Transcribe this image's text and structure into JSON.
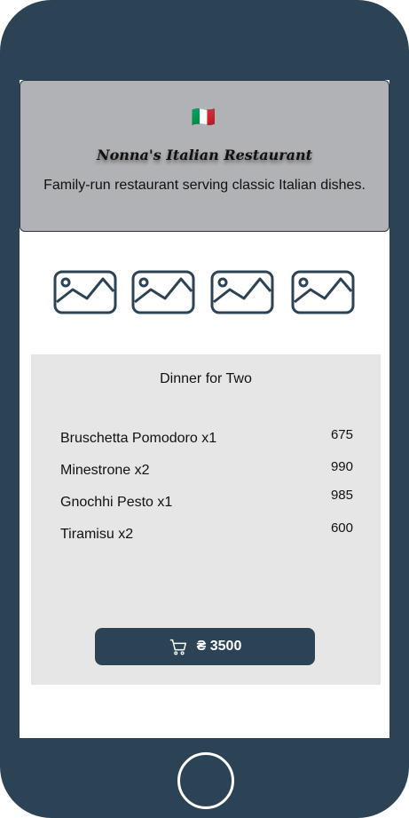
{
  "restaurant": {
    "logo": "🇮🇹",
    "name": "Nonna's Italian Restaurant",
    "description": "Family-run restaurant serving classic Italian dishes."
  },
  "gallery": {
    "icons": [
      "image-icon",
      "image-icon",
      "image-icon",
      "image-icon"
    ]
  },
  "menu": {
    "title": "Dinner for Two",
    "items": [
      {
        "name": "Bruschetta Pomodoro x1",
        "price": "675"
      },
      {
        "name": "Minestrone x2",
        "price": "990"
      },
      {
        "name": "Gnochhi Pesto x1",
        "price": "985"
      },
      {
        "name": "Tiramisu x2",
        "price": "600"
      }
    ],
    "cart_button": {
      "icon": "cart-icon",
      "label": "₴ 3500"
    }
  },
  "colors": {
    "phone_frame": "#2c4355",
    "header_bg": "#b1b2b6",
    "menu_bg": "#e6e6e6",
    "button_bg": "#2c4355",
    "button_text": "#ffffff"
  }
}
